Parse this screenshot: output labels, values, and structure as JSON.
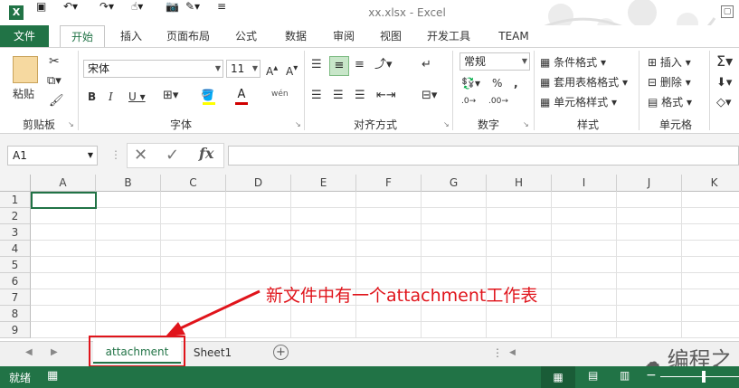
{
  "window": {
    "title": "xx.xlsx - Excel"
  },
  "tabs": [
    "文件",
    "开始",
    "插入",
    "页面布局",
    "公式",
    "数据",
    "审阅",
    "视图",
    "开发工具",
    "TEAM"
  ],
  "ribbon": {
    "paste_label": "粘贴",
    "font_name": "宋体",
    "font_size": "11",
    "number_format": "常规",
    "phonetic": "wén",
    "style_items": [
      "条件格式",
      "套用表格格式",
      "单元格样式"
    ],
    "cell_items": [
      "插入",
      "删除",
      "格式"
    ],
    "group_labels": [
      "剪贴板",
      "字体",
      "对齐方式",
      "数字",
      "样式",
      "单元格"
    ]
  },
  "formula_bar": {
    "name_box": "A1",
    "fx": "fx",
    "value": ""
  },
  "grid": {
    "columns": [
      "A",
      "B",
      "C",
      "D",
      "E",
      "F",
      "G",
      "H",
      "I",
      "J",
      "K"
    ],
    "rows": [
      "1",
      "2",
      "3",
      "4",
      "5",
      "6",
      "7",
      "8",
      "9"
    ]
  },
  "sheets": {
    "tabs": [
      "attachment",
      "Sheet1"
    ],
    "active": "attachment"
  },
  "annotation": "新文件中有一个attachment工作表",
  "status": {
    "ready": "就绪"
  },
  "watermark": "编程之",
  "colors": {
    "accent": "#217346",
    "highlight": "#e0141b"
  }
}
